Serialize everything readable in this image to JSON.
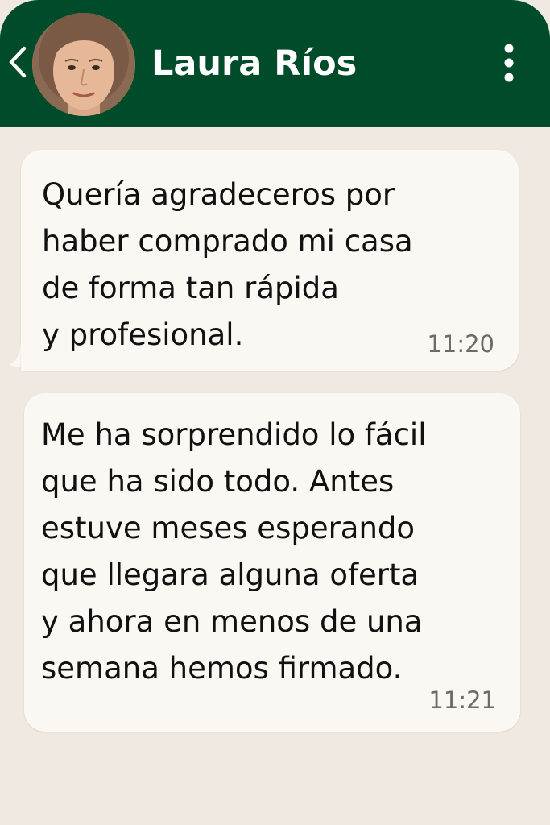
{
  "header": {
    "contact_name": "Laura Ríos",
    "back_icon": "chevron-left-icon",
    "menu_icon": "more-vertical-icon",
    "background_color": "#004B2A"
  },
  "messages": [
    {
      "text": "Quería agradeceros por\nhaber comprado mi casa\nde forma tan rápida\ny profesional.",
      "time": "11:20"
    },
    {
      "text": "Me ha sorprendido lo fácil\nque ha sido todo. Antes\nestuve meses esperando\nque llegara alguna oferta\ny ahora en menos de una\nsemana hemos firmado.",
      "time": "11:21"
    }
  ],
  "colors": {
    "chat_background": "#EFE9E1",
    "bubble": "#FBF7F3",
    "timestamp": "#6B6B6B"
  }
}
